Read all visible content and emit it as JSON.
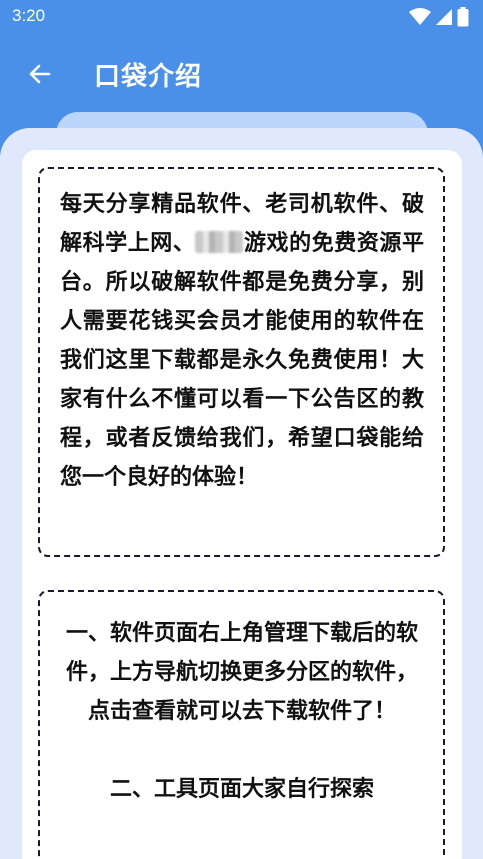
{
  "status_bar": {
    "time": "3:20",
    "icons": [
      "wifi-icon",
      "cell-signal-icon",
      "battery-icon"
    ]
  },
  "app_bar": {
    "back_icon": "arrow-left-icon",
    "title": "口袋介绍"
  },
  "colors": {
    "header_blue": "#4a90e8",
    "sheet_bg": "#dfe9fb",
    "tab_hint": "#bcd6fb",
    "text": "#111111",
    "border": "#1a1a2e"
  },
  "intro_box": {
    "text_part1": "每天分享精品软件、老司机软件、破解科学上网、",
    "text_part2": "游戏的免费资源平台。所以破解软件都是免费分享，别人需要花钱买会员才能使用的软件在我们这里下载都是永久免费使用！大家有什么不懂可以看一下公告区的教程，或者反馈给我们，希望口袋能给您一个良好的体验！"
  },
  "guide_box": {
    "item1": "一、软件页面右上角管理下载后的软件，上方导航切换更多分区的软件，点击查看就可以去下载软件了！",
    "item2": "二、工具页面大家自行探索"
  }
}
